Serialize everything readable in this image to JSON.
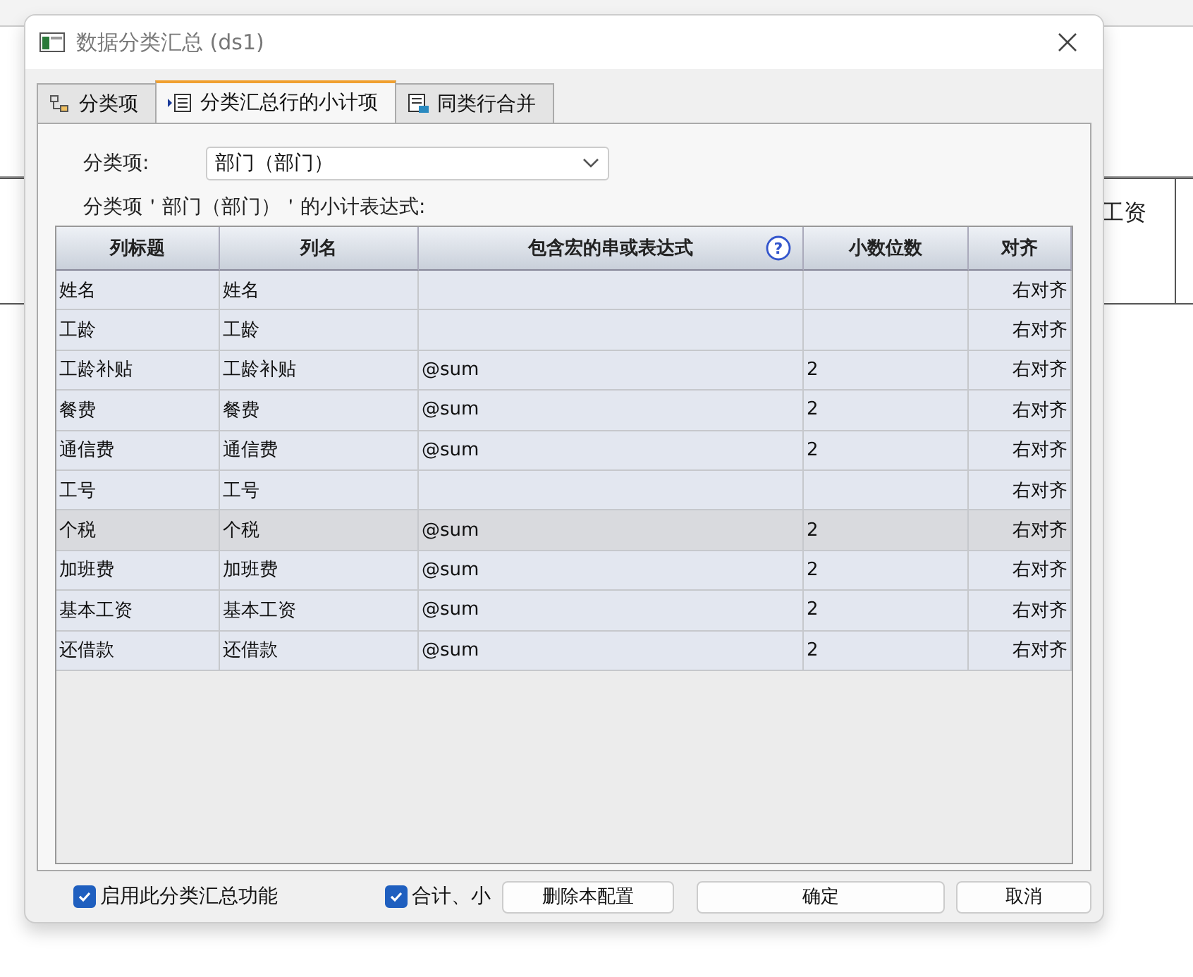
{
  "background_sheet": {
    "cell_text": "工资"
  },
  "window": {
    "title": "数据分类汇总 (ds1)"
  },
  "tabs": [
    {
      "label": "分类项",
      "selected": false
    },
    {
      "label": "分类汇总行的小计项",
      "selected": true
    },
    {
      "label": "同类行合并",
      "selected": false
    }
  ],
  "group_field": {
    "label": "分类项:",
    "value": "部门（部门）"
  },
  "expression_caption": "分类项＇部门（部门）＇的小计表达式:",
  "table": {
    "help_mark": "?",
    "columns": [
      "列标题",
      "列名",
      "包含宏的串或表达式",
      "小数位数",
      "对齐"
    ],
    "rows": [
      {
        "cells": [
          "姓名",
          "姓名",
          "",
          "",
          "右对齐"
        ],
        "selected": false
      },
      {
        "cells": [
          "工龄",
          "工龄",
          "",
          "",
          "右对齐"
        ],
        "selected": false
      },
      {
        "cells": [
          "工龄补贴",
          "工龄补贴",
          "@sum",
          "2",
          "右对齐"
        ],
        "selected": false
      },
      {
        "cells": [
          "餐费",
          "餐费",
          "@sum",
          "2",
          "右对齐"
        ],
        "selected": false
      },
      {
        "cells": [
          "通信费",
          "通信费",
          "@sum",
          "2",
          "右对齐"
        ],
        "selected": false
      },
      {
        "cells": [
          "工号",
          "工号",
          "",
          "",
          "右对齐"
        ],
        "selected": false
      },
      {
        "cells": [
          "个税",
          "个税",
          "@sum",
          "2",
          "右对齐"
        ],
        "selected": true
      },
      {
        "cells": [
          "加班费",
          "加班费",
          "@sum",
          "2",
          "右对齐"
        ],
        "selected": false
      },
      {
        "cells": [
          "基本工资",
          "基本工资",
          "@sum",
          "2",
          "右对齐"
        ],
        "selected": false
      },
      {
        "cells": [
          "还借款",
          "还借款",
          "@sum",
          "2",
          "右对齐"
        ],
        "selected": false
      }
    ]
  },
  "footer": {
    "checkboxes": [
      {
        "label": "启用此分类汇总功能",
        "checked": true
      },
      {
        "label": "合计、小",
        "checked": true
      }
    ],
    "buttons": [
      "删除本配置",
      "确定",
      "取消"
    ]
  }
}
